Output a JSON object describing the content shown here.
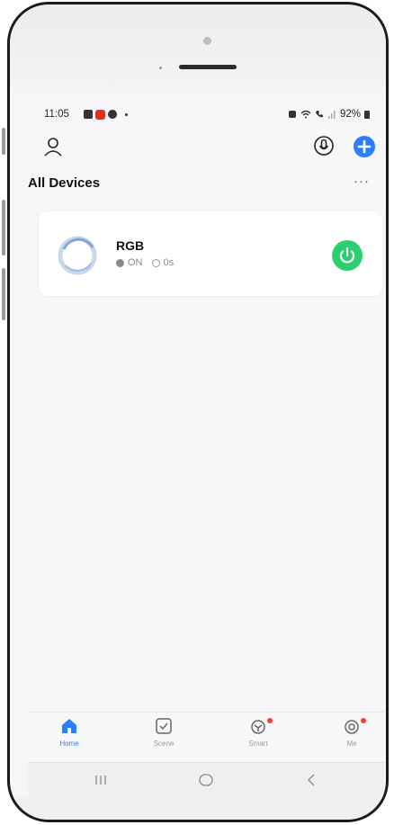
{
  "status_bar": {
    "time": "11:05",
    "battery": "92%"
  },
  "header": {
    "section_title": "All Devices",
    "more_label": "···"
  },
  "device": {
    "name": "RGB",
    "state": "ON",
    "timer": "0s",
    "power_color": "#2ccf6f"
  },
  "tabs": [
    {
      "label": "Home",
      "icon": "home-icon",
      "active": true
    },
    {
      "label": "Scene",
      "icon": "scene-icon",
      "active": false
    },
    {
      "label": "Smart",
      "icon": "smart-icon",
      "active": false
    },
    {
      "label": "Me",
      "icon": "me-icon",
      "active": false
    }
  ],
  "nav": {
    "recent": "recent-apps-icon",
    "home": "home-circle-icon",
    "back": "back-icon"
  },
  "colors": {
    "accent": "#2b7fff",
    "on_green": "#2ccf6f",
    "badge_red": "#ff3b30"
  }
}
